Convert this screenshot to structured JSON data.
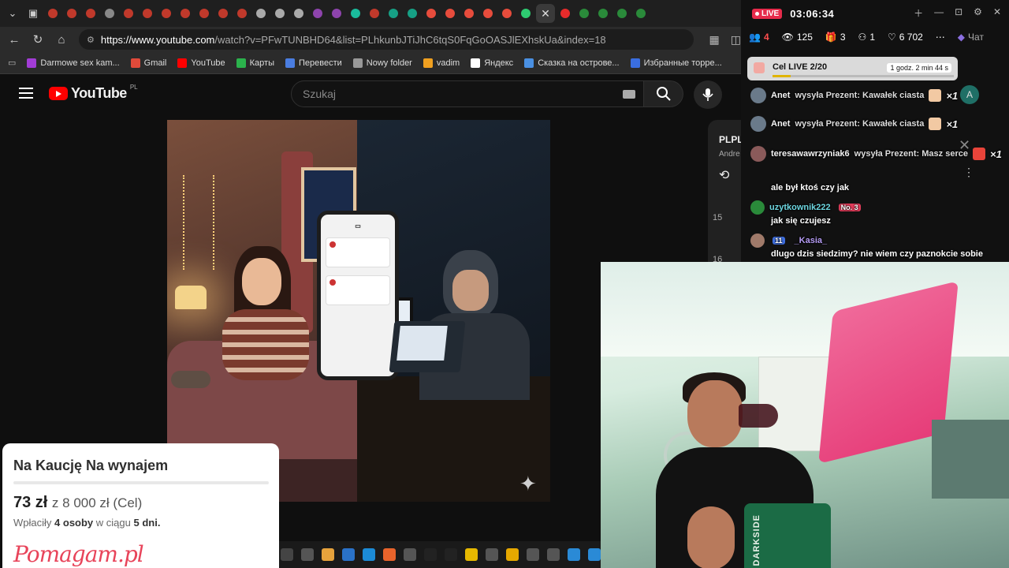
{
  "browser": {
    "url_host": "https://www.youtube.com",
    "url_path": "/watch?v=PFwTUNBHD64&list=PLhkunbJTiJhC6tqS0FqGoOASJlEXhskUa&index=18",
    "tab_colors": [
      "#c0392b",
      "#c0392b",
      "#c0392b",
      "#888888",
      "#c0392b",
      "#c0392b",
      "#c0392b",
      "#c0392b",
      "#c0392b",
      "#c0392b",
      "#c0392b",
      "#aaaaaa",
      "#aaaaaa",
      "#aaaaaa",
      "#8e44ad",
      "#8e44ad",
      "#1abc9c",
      "#c0392b",
      "#16a085",
      "#16a085",
      "#e74c3c",
      "#e74c3c",
      "#e74c3c",
      "#e74c3c",
      "#e74c3c",
      "#2ecc71"
    ],
    "bookmarks": [
      {
        "label": "Darmowe sex kam...",
        "color": "#a23cd6"
      },
      {
        "label": "Gmail",
        "color": "#e04a3a"
      },
      {
        "label": "YouTube",
        "color": "#ff0000"
      },
      {
        "label": "Карты",
        "color": "#2bb24c"
      },
      {
        "label": "Перевести",
        "color": "#4a7de0"
      },
      {
        "label": "Nowy folder",
        "color": "#999999"
      },
      {
        "label": "vadim",
        "color": "#f0a020"
      },
      {
        "label": "Яндекс",
        "color": "#ffffff"
      },
      {
        "label": "Сказка на острове...",
        "color": "#4a90e2"
      },
      {
        "label": "Избранные торре...",
        "color": "#3a6ee0"
      }
    ]
  },
  "youtube": {
    "logo_text": "YouTube",
    "country_code": "PL",
    "search_placeholder": "Szukaj",
    "playlist_title": "PLPL",
    "playlist_sub": "Andre",
    "playlist_numbers": [
      "15",
      "16"
    ]
  },
  "donation_card": {
    "title": "Na Kaucję Na wynajem",
    "amount": "73 zł",
    "goal": "z 8 000 zł (Cel)",
    "meta_prefix": "Wpłaciły",
    "people": "4 osoby",
    "meta_mid": "w ciągu",
    "days": "5 dni.",
    "brand": "Pomagam.pl"
  },
  "stream": {
    "live_label": "LIVE",
    "timer": "03:06:34",
    "stats": {
      "guests": "4",
      "viewers": "125",
      "gifts": "3",
      "follows": "1",
      "likes": "6 702",
      "chat": "Чат"
    },
    "goal_label": "Cel LIVE 2/20",
    "goal_time": "1 godz. 2 min 44 s",
    "goal_progress": 0.1,
    "avatar_letter": "A",
    "gift_lines": [
      {
        "name": "Anet",
        "action": "wysyła Prezent: Kawałek ciasta",
        "count": "×1"
      },
      {
        "name": "Anet",
        "action": "wysyła Prezent: Kawałek ciasta",
        "count": "×1"
      },
      {
        "name": "teresawawrzyniak6",
        "action": "wysyła Prezent: Masz serce",
        "count": "×1"
      }
    ],
    "messages": {
      "m1": "ale był ktoś czy jak",
      "user2": "uzytkownik222",
      "user2_level": "No. 3",
      "m2": "jak się czujesz",
      "user3_level": "11",
      "user3": "_Kasia_",
      "m3": "dlugo dzis siedzimy? nie wiem czy paznokcie sobie"
    }
  },
  "webcam": {
    "mug_text": "DARKSIDE"
  },
  "taskbar": {
    "icons": [
      "search-icon",
      "task-view-icon",
      "explorer-icon",
      "mail-icon",
      "edge-icon",
      "firefox-icon",
      "widgets-icon",
      "tiktok-icon",
      "r-icon",
      "chrome-icon",
      "blocked-icon",
      "star-icon",
      "store-icon",
      "game-icon",
      "photos-icon",
      "check-icon"
    ]
  }
}
